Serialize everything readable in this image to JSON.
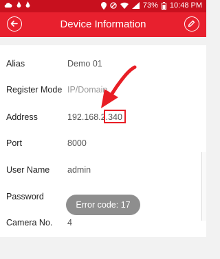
{
  "status_bar": {
    "battery": "73%",
    "time": "10:48 PM"
  },
  "header": {
    "title": "Device Information",
    "back_icon": "back-circle-icon",
    "edit_icon": "edit-pencil-icon"
  },
  "form": {
    "rows": [
      {
        "label": "Alias",
        "value": "Demo 01"
      },
      {
        "label": "Register Mode",
        "value": "IP/Domain"
      },
      {
        "label": "Address",
        "value": "192.168.2.340"
      },
      {
        "label": "Port",
        "value": "8000"
      },
      {
        "label": "User Name",
        "value": "admin"
      },
      {
        "label": "Password",
        "value": ""
      },
      {
        "label": "Camera No.",
        "value": "4"
      }
    ]
  },
  "toast": {
    "text": "Error code: 17"
  },
  "colors": {
    "header": "#e8202e",
    "status_bar": "#c8101e",
    "annotation": "#e81e25"
  }
}
